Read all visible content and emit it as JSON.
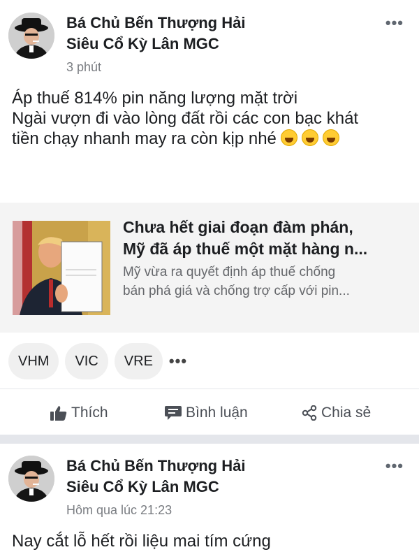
{
  "posts": [
    {
      "author_line1": "Bá Chủ Bến Thượng Hải",
      "author_line2": "Siêu Cổ Kỳ Lân MGC",
      "time": "3 phút",
      "text_line1": "Áp thuế 814% pin năng lượng mặt trời",
      "text_line2": "Ngài vượn đi vào lòng đất rồi các con bạc khát",
      "text_line3": "tiền chạy nhanh may ra còn kịp nhé",
      "emojis": [
        "rolling-laughing-emoji",
        "tears-of-joy-emoji",
        "star-struck-emoji"
      ],
      "link": {
        "title_line1": "Chưa hết giai đoạn đàm phán,",
        "title_line2": "Mỹ đã áp thuế một mặt hàng n...",
        "desc_line1": "Mỹ vừa ra quyết định áp thuế chống",
        "desc_line2": "bán phá giá và chống trợ cấp với pin..."
      },
      "tags": [
        "VHM",
        "VIC",
        "VRE"
      ],
      "tags_more": "•••",
      "actions": {
        "like": "Thích",
        "comment": "Bình luận",
        "share": "Chia sẻ"
      }
    },
    {
      "author_line1": "Bá Chủ Bến Thượng Hải",
      "author_line2": "Siêu Cổ Kỳ Lân MGC",
      "time": "Hôm qua lúc 21:23",
      "text_line1": "Nay cắt lỗ hết rồi liệu mai tím cứng"
    }
  ],
  "more_icon": "•••",
  "colors": {
    "divider": "#e4e6eb",
    "card_bg": "#f4f4f4",
    "tag_bg": "#f0f0f0",
    "muted": "#65676b"
  }
}
